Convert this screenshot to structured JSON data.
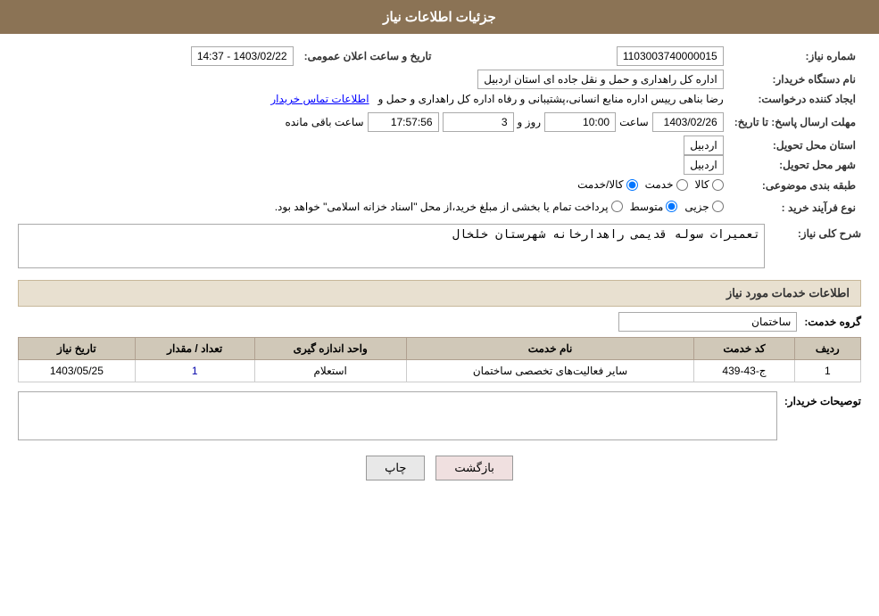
{
  "header": {
    "title": "جزئیات اطلاعات نیاز"
  },
  "fields": {
    "need_number_label": "شماره نیاز:",
    "need_number_value": "1103003740000015",
    "buyer_org_label": "نام دستگاه خریدار:",
    "buyer_org_value": "اداره کل راهداری و حمل و نقل جاده ای استان اردبیل",
    "creator_label": "ایجاد کننده درخواست:",
    "creator_value": "رضا بناهی رییس اداره منابع انسانی،پشتیبانی و رفاه اداره کل راهداری و حمل و",
    "creator_link": "اطلاعات تماس خریدار",
    "announce_date_label": "تاریخ و ساعت اعلان عمومی:",
    "announce_date_value": "1403/02/22 - 14:37",
    "reply_deadline_label": "مهلت ارسال پاسخ: تا تاریخ:",
    "reply_date": "1403/02/26",
    "reply_time_label": "ساعت",
    "reply_time": "10:00",
    "reply_days_label": "روز و",
    "reply_days": "3",
    "remaining_label": "ساعت باقی مانده",
    "remaining_time": "17:57:56",
    "province_label": "استان محل تحویل:",
    "province_value": "اردبیل",
    "city_label": "شهر محل تحویل:",
    "city_value": "اردبیل",
    "category_label": "طبقه بندی موضوعی:",
    "category_options": [
      "کالا",
      "خدمت",
      "کالا/خدمت"
    ],
    "category_selected": "کالا",
    "purchase_type_label": "نوع فرآیند خرید :",
    "purchase_type_options": [
      "جزیی",
      "متوسط",
      "پرداخت تمام یا بخشی از مبلغ خرید،از محل \"اسناد خزانه اسلامی\" خواهد بود."
    ],
    "purchase_type_selected": "متوسط",
    "need_desc_label": "شرح کلی نیاز:",
    "need_desc_value": "تعمیرات سوله قدیمی راهدارخانه شهرستان خلخال",
    "services_section": "اطلاعات خدمات مورد نیاز",
    "service_group_label": "گروه خدمت:",
    "service_group_value": "ساختمان",
    "table": {
      "headers": [
        "ردیف",
        "کد خدمت",
        "نام خدمت",
        "واحد اندازه گیری",
        "تعداد / مقدار",
        "تاریخ نیاز"
      ],
      "rows": [
        {
          "row_num": "1",
          "service_code": "ج-43-439",
          "service_name": "سایر فعالیت‌های تخصصی ساختمان",
          "unit": "استعلام",
          "quantity": "1",
          "date": "1403/05/25"
        }
      ]
    },
    "buyer_notes_label": "توصیحات خریدار:",
    "buttons": {
      "back": "بازگشت",
      "print": "چاپ"
    }
  }
}
